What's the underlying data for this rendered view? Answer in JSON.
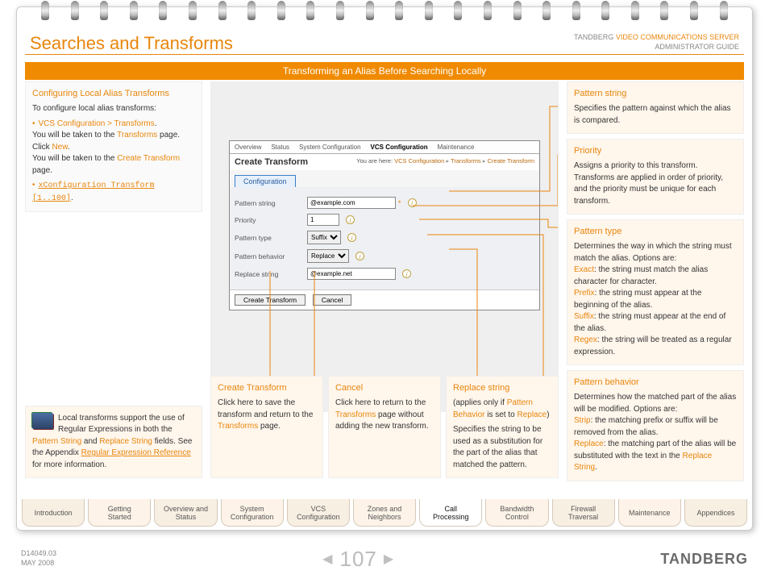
{
  "header": {
    "page_title": "Searches and Transforms",
    "guide_line1_prefix": "TANDBERG ",
    "guide_line1_hl": "VIDEO COMMUNICATIONS SERVER",
    "guide_line2": "ADMINISTRATOR GUIDE",
    "orange_bar": "Transforming an Alias Before Searching Locally"
  },
  "left": {
    "title": "Configuring Local Alias Transforms",
    "intro": "To configure local alias transforms:",
    "step1_link": "VCS Configuration > Transforms",
    "step1_body_a": "You will be taken to the ",
    "step1_body_link": "Transforms",
    "step1_body_b": " page. Click ",
    "step1_body_new": "New",
    "step1_body_c": ".",
    "step1_line2_a": "You will be taken to the ",
    "step1_line2_link": "Create Transform",
    "step1_line2_b": " page.",
    "step2_code": "xConfiguration Transform [1..100]",
    "tip_a": "Local transforms support the use of Regular Expressions in both the ",
    "tip_link1": "Pattern String",
    "tip_and": " and ",
    "tip_link2": "Replace String",
    "tip_b": " fields.  See the Appendix ",
    "tip_link3": "Regular Expression Reference",
    "tip_c": " for more information."
  },
  "screenshot": {
    "tabs": [
      "Overview",
      "Status",
      "System Configuration",
      "VCS Configuration",
      "Maintenance"
    ],
    "active_tab_index": 3,
    "title": "Create Transform",
    "crumb_prefix": "You are here: ",
    "crumb_parts": [
      "VCS Configuration",
      "Transforms",
      "Create Transform"
    ],
    "config_tab": "Configuration",
    "fields": {
      "pattern_string": {
        "label": "Pattern string",
        "value": "@example.com"
      },
      "priority": {
        "label": "Priority",
        "value": "1"
      },
      "pattern_type": {
        "label": "Pattern type",
        "value": "Suffix"
      },
      "pattern_behavior": {
        "label": "Pattern behavior",
        "value": "Replace"
      },
      "replace_string": {
        "label": "Replace string",
        "value": "@example.net"
      }
    },
    "btn_create": "Create Transform",
    "btn_cancel": "Cancel"
  },
  "mid_notes": {
    "create": {
      "title": "Create Transform",
      "text_a": "Click here to save the transform and return to the ",
      "link": "Transforms",
      "text_b": " page."
    },
    "cancel": {
      "title": "Cancel",
      "text_a": "Click here to return to the ",
      "link": "Transforms",
      "text_b": " page without adding the new transform."
    },
    "replace": {
      "title": "Replace string",
      "apply_a": "(applies only if ",
      "apply_link1": "Pattern Behavior",
      "apply_b": " is set to ",
      "apply_link2": "Replace",
      "apply_c": ")",
      "text": "Specifies the string to be used as a substitution for the part of the alias that matched the pattern."
    }
  },
  "right": {
    "ps": {
      "title": "Pattern string",
      "text": "Specifies the pattern against which the alias is compared."
    },
    "pr": {
      "title": "Priority",
      "text": "Assigns a priority to this transform. Transforms are applied in order of priority, and the priority must be unique for each transform."
    },
    "pt": {
      "title": "Pattern type",
      "intro": "Determines the way in which the string must match the alias. Options are:",
      "o1_l": "Exact",
      "o1_t": ": the string must match the alias character for character.",
      "o2_l": "Prefix",
      "o2_t": ": the string must appear at the beginning of the alias.",
      "o3_l": "Suffix",
      "o3_t": ": the string must appear at the end of the alias.",
      "o4_l": "Regex",
      "o4_t": ": the string will be treated as a regular expression."
    },
    "pb": {
      "title": "Pattern behavior",
      "intro": "Determines how the matched part of the alias will be modified. Options are:",
      "o1_l": "Strip",
      "o1_t": ": the matching prefix or suffix will be removed from the alias.",
      "o2_l": "Replace",
      "o2_t": ": the matching part of the alias will be substituted with the text in the ",
      "o2_link": "Replace String",
      "o2_t2": "."
    }
  },
  "tabs": [
    "Introduction",
    "Getting Started",
    "Overview and Status",
    "System Configuration",
    "VCS Configuration",
    "Zones and Neighbors",
    "Call Processing",
    "Bandwidth Control",
    "Firewall Traversal",
    "Maintenance",
    "Appendices"
  ],
  "active_tab_index": 6,
  "footer": {
    "docid": "D14049.03",
    "date": "MAY 2008",
    "page": "107",
    "brand": "TANDBERG"
  }
}
